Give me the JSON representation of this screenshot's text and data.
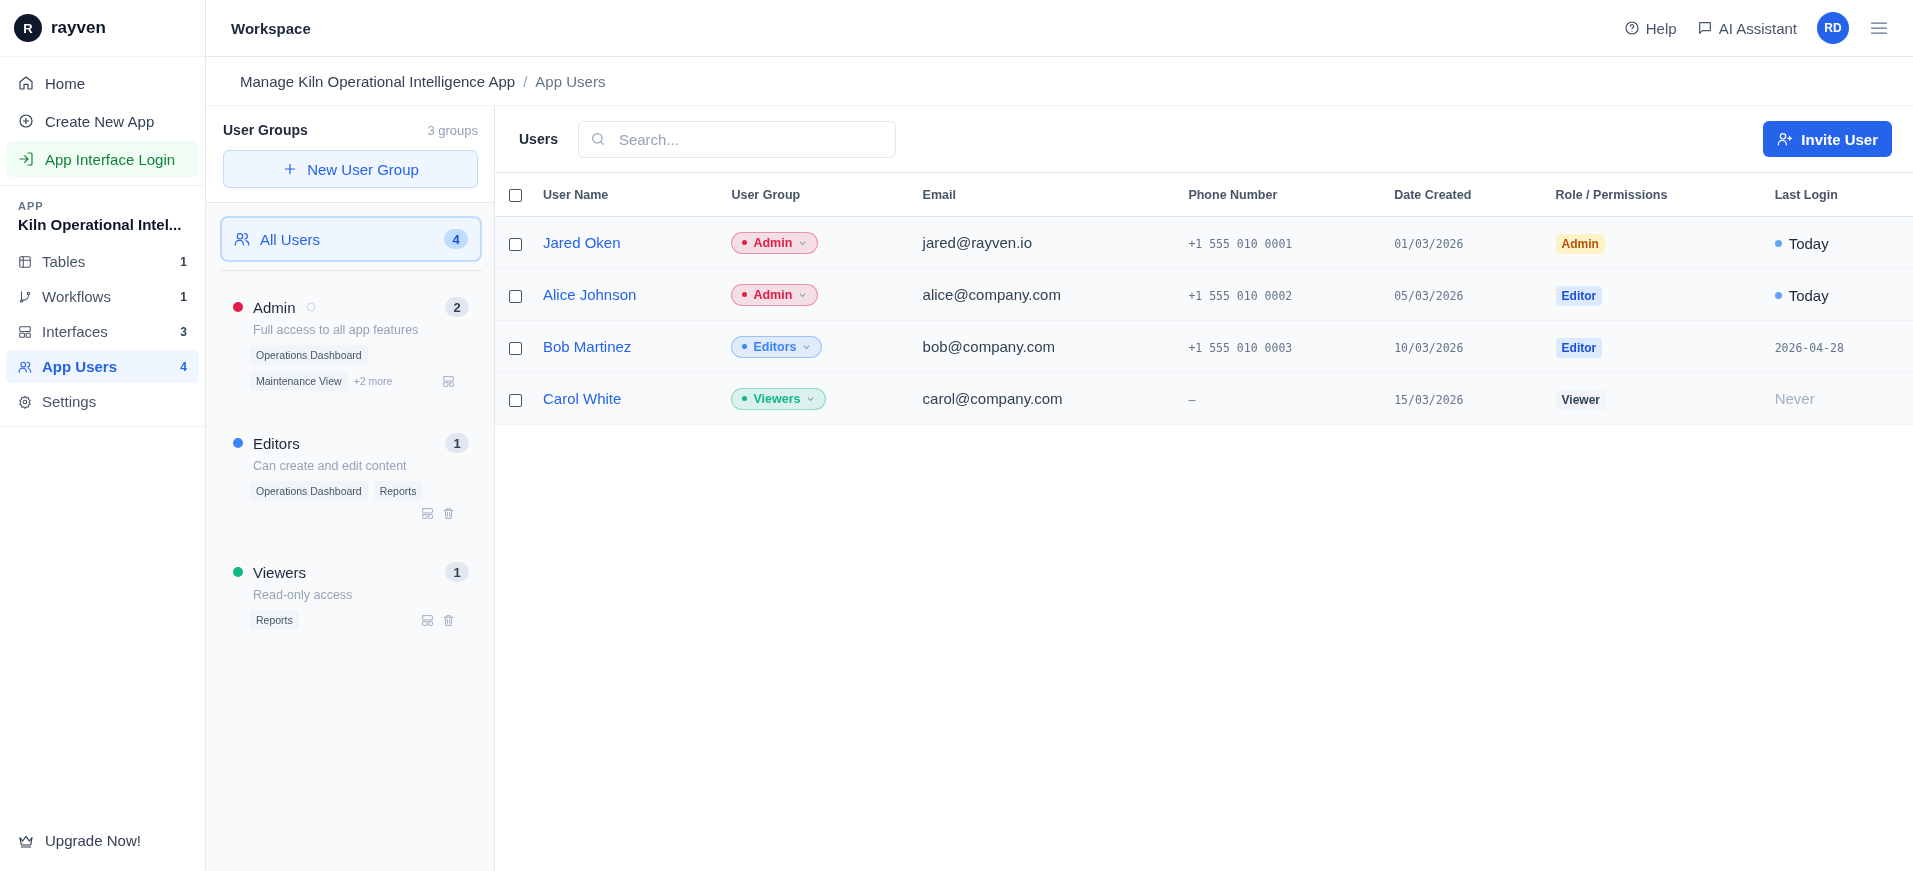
{
  "brand": {
    "initial": "R",
    "name": "rayven"
  },
  "topbar": {
    "title": "Workspace",
    "help": "Help",
    "assistant": "AI Assistant",
    "avatar": "RD"
  },
  "nav": [
    {
      "label": "Home",
      "selected": false,
      "highlight": false
    },
    {
      "label": "Create New App",
      "selected": false,
      "highlight": false
    },
    {
      "label": "App Interface Login",
      "selected": false,
      "highlight": true
    }
  ],
  "app_section": {
    "label": "APP",
    "name": "Kiln Operational Intel...",
    "items": [
      {
        "label": "Tables",
        "count": "1",
        "selected": false
      },
      {
        "label": "Workflows",
        "count": "1",
        "selected": false
      },
      {
        "label": "Interfaces",
        "count": "3",
        "selected": false
      },
      {
        "label": "App Users",
        "count": "4",
        "selected": true
      },
      {
        "label": "Settings",
        "selected": false
      }
    ]
  },
  "upgrade": "Upgrade Now!",
  "breadcrumb_separator": "/",
  "breadcrumb": [
    "Manage Kiln Operational Intelligence App",
    "App Users"
  ],
  "groups_panel": {
    "title": "User Groups",
    "count": "3 groups",
    "new_button": "New User Group",
    "all_users": {
      "label": "All Users",
      "count": "4",
      "selected": true
    },
    "groups": [
      {
        "name": "Admin",
        "color": "#e11d48",
        "count": "2",
        "pending": true,
        "description": "Full access to all app features",
        "apps": [
          "Operations Dashboard",
          "Maintenance View"
        ],
        "more": "+2 more",
        "deletable": false,
        "selected": false
      },
      {
        "name": "Editors",
        "color": "#3b82f6",
        "count": "1",
        "pending": false,
        "description": "Can create and edit content",
        "apps": [
          "Operations Dashboard",
          "Reports"
        ],
        "deletable": true,
        "selected": false
      },
      {
        "name": "Viewers",
        "color": "#10b981",
        "count": "1",
        "pending": false,
        "description": "Read-only access",
        "apps": [
          "Reports"
        ],
        "deletable": true,
        "selected": false
      }
    ]
  },
  "users_panel": {
    "title": "Users",
    "search": {
      "placeholder": "Search..."
    },
    "invite_button": "Invite User",
    "columns": [
      "User Name",
      "User Group",
      "Email",
      "Phone Number",
      "Date Created",
      "Role / Permissions",
      "Last Login"
    ],
    "all_checked": false,
    "rows": [
      {
        "checked": false,
        "name": "Jared Oken",
        "group": {
          "label": "Admin",
          "color": "#e11d48"
        },
        "email": "jared@rayven.io",
        "phone": "+1 555 010 0001",
        "created": "01/03/2026",
        "role": {
          "label": "Admin",
          "kind": "admin"
        },
        "last_login": {
          "text": "Today",
          "kind": "recent"
        }
      },
      {
        "checked": false,
        "name": "Alice Johnson",
        "group": {
          "label": "Admin",
          "color": "#e11d48"
        },
        "email": "alice@company.com",
        "phone": "+1 555 010 0002",
        "created": "05/03/2026",
        "role": {
          "label": "Editor",
          "kind": "editor"
        },
        "last_login": {
          "text": "Today",
          "kind": "recent"
        }
      },
      {
        "checked": false,
        "name": "Bob Martinez",
        "group": {
          "label": "Editors",
          "color": "#3b82f6"
        },
        "email": "bob@company.com",
        "phone": "+1 555 010 0003",
        "created": "10/03/2026",
        "role": {
          "label": "Editor",
          "kind": "editor"
        },
        "last_login": {
          "text": "2026-04-28",
          "kind": "date"
        }
      },
      {
        "checked": false,
        "name": "Carol White",
        "group": {
          "label": "Viewers",
          "color": "#10b981"
        },
        "email": "carol@company.com",
        "phone": "–",
        "created": "15/03/2026",
        "role": {
          "label": "Viewer",
          "kind": "viewer"
        },
        "last_login": {
          "text": "Never",
          "kind": "never"
        }
      }
    ]
  }
}
